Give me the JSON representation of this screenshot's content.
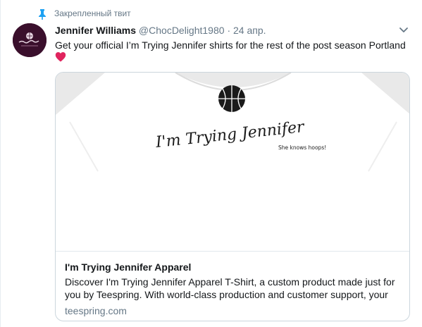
{
  "pinned": {
    "label": "Закрепленный твит",
    "icon": "pin-icon"
  },
  "tweet": {
    "author_name": "Jennifer Williams",
    "handle": "@ChocDelight1980",
    "separator": "·",
    "timestamp": "24 апр.",
    "text": "Get your official I’m Trying Jennifer shirts for the rest of the post season Portland",
    "emoji": "red-heart"
  },
  "card": {
    "image": {
      "shirt_text": "I'm Trying Jennifer",
      "shirt_subtext": "She knows hoops!"
    },
    "title": "I'm Trying Jennifer Apparel",
    "description": "Discover I'm Trying Jennifer Apparel T-Shirt, a custom product made just for you by Teespring. With world-class production and customer support, your",
    "domain": "teespring.com"
  },
  "colors": {
    "accent": "#1da1f2",
    "heart": "#e0245e",
    "secondary_text": "#657786",
    "border": "#ccd6dd"
  }
}
